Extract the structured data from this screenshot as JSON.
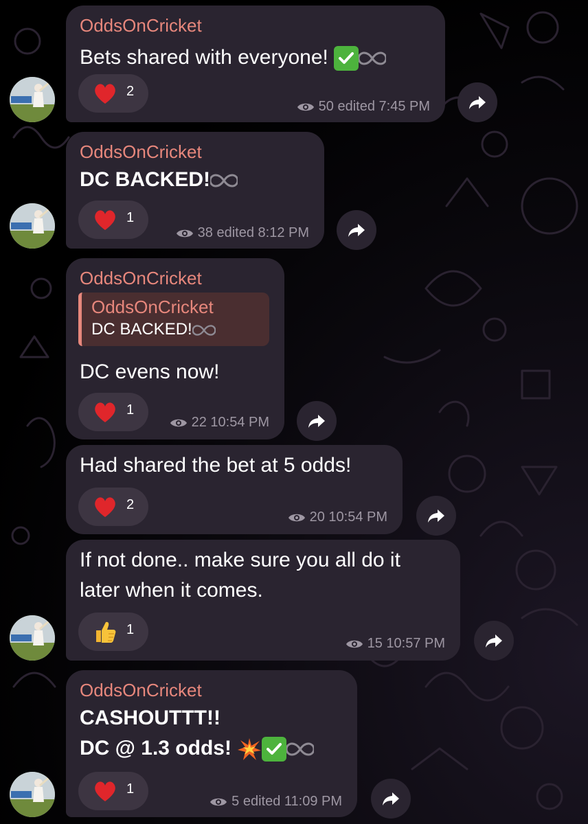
{
  "channel": {
    "sender_name": "OddsOnCricket",
    "accent_color": "#e7877c",
    "bubble_color": "#2a2430"
  },
  "messages": [
    {
      "sender": "OddsOnCricket",
      "text": "Bets shared with everyone!",
      "emoji_suffix": [
        "check-mark-icon",
        "infinity-icon"
      ],
      "reaction": {
        "emoji": "heart-icon",
        "count": "2"
      },
      "views": "50",
      "meta": "edited 7:45 PM"
    },
    {
      "sender": "OddsOnCricket",
      "text": "DC BACKED!",
      "emoji_suffix": [
        "infinity-icon"
      ],
      "reaction": {
        "emoji": "heart-icon",
        "count": "1"
      },
      "views": "38",
      "meta": "edited 8:12 PM"
    },
    {
      "sender": "OddsOnCricket",
      "reply": {
        "sender": "OddsOnCricket",
        "text": "DC BACKED!"
      },
      "text": "DC evens now!",
      "reaction": {
        "emoji": "heart-icon",
        "count": "1"
      },
      "views": "22",
      "meta": "10:54 PM"
    },
    {
      "text": "Had shared the bet at 5 odds!",
      "reaction": {
        "emoji": "heart-icon",
        "count": "2"
      },
      "views": "20",
      "meta": "10:54 PM"
    },
    {
      "text_line1": "If not done.. make sure you all do it",
      "text_line2": "later when it comes.",
      "reaction": {
        "emoji": "thumbs-up-icon",
        "count": "1"
      },
      "views": "15",
      "meta": "10:57 PM"
    },
    {
      "sender": "OddsOnCricket",
      "text_line1": "CASHOUTTT!!",
      "text_line2": "DC @ 1.3 odds!",
      "emoji_suffix": [
        "collision-icon",
        "check-mark-icon",
        "infinity-icon"
      ],
      "reaction": {
        "emoji": "heart-icon",
        "count": "1"
      },
      "views": "5",
      "meta": "edited 11:09 PM"
    }
  ]
}
